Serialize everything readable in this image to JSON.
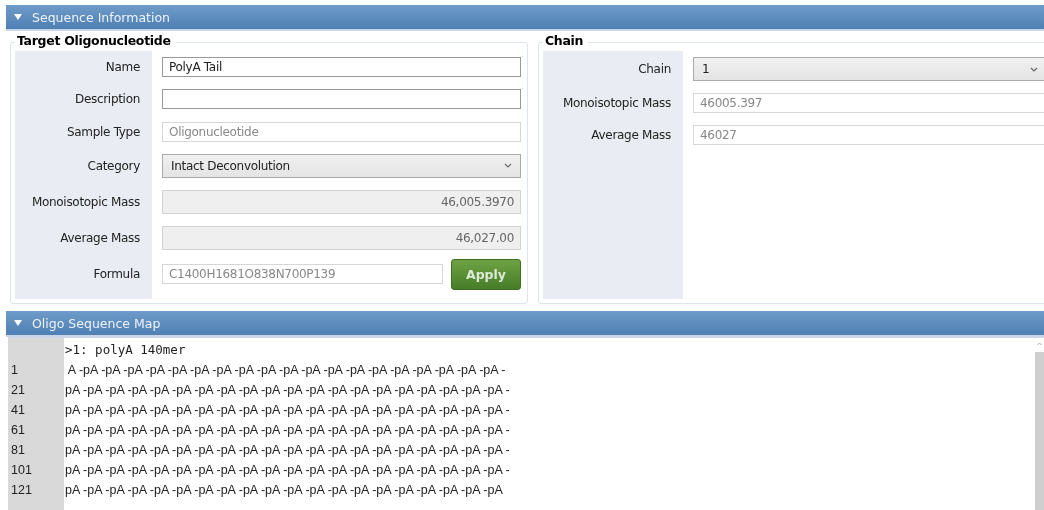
{
  "sequence_information": {
    "title": "Sequence Information",
    "expanded": true,
    "target_oligonucleotide": {
      "title": "Target Oligonucleotide",
      "fields": [
        {
          "label": "Name",
          "kind": "text",
          "value": "PolyA Tail"
        },
        {
          "label": "Description",
          "kind": "text"
        },
        {
          "label": "Sample Type",
          "kind": "readonly",
          "value": "Oligonucleotide"
        },
        {
          "label": "Category",
          "kind": "select",
          "value": "Intact Deconvolution"
        },
        {
          "label": "Monoisotopic Mass",
          "kind": "number",
          "value": "46,005.3970"
        },
        {
          "label": "Average Mass",
          "kind": "number",
          "value": "46,027.00"
        },
        {
          "label": "Formula",
          "kind": "formula",
          "value": "C1400H1681O838N700P139",
          "button": "Apply"
        }
      ]
    },
    "chain": {
      "title": "Chain",
      "fields": [
        {
          "label": "Chain",
          "kind": "select",
          "value": "1"
        },
        {
          "label": "Monoisotopic Mass",
          "kind": "readonly",
          "value": "46005.397"
        },
        {
          "label": "Average Mass",
          "kind": "readonly",
          "value": "46027"
        }
      ]
    }
  },
  "oligo_sequence_map": {
    "title": "Oligo Sequence Map",
    "expanded": true,
    "header": ">1: polyA 140mer",
    "lines": [
      {
        "number": "1",
        "text": " A -pA -pA -pA -pA -pA -pA -pA -pA -pA -pA -pA -pA -pA -pA -pA -pA -pA -pA -pA -"
      },
      {
        "number": "21",
        "text": "pA -pA -pA -pA -pA -pA -pA -pA -pA -pA -pA -pA -pA -pA -pA -pA -pA -pA -pA -pA -"
      },
      {
        "number": "41",
        "text": "pA -pA -pA -pA -pA -pA -pA -pA -pA -pA -pA -pA -pA -pA -pA -pA -pA -pA -pA -pA -"
      },
      {
        "number": "61",
        "text": "pA -pA -pA -pA -pA -pA -pA -pA -pA -pA -pA -pA -pA -pA -pA -pA -pA -pA -pA -pA -"
      },
      {
        "number": "81",
        "text": "pA -pA -pA -pA -pA -pA -pA -pA -pA -pA -pA -pA -pA -pA -pA -pA -pA -pA -pA -pA -"
      },
      {
        "number": "101",
        "text": "pA -pA -pA -pA -pA -pA -pA -pA -pA -pA -pA -pA -pA -pA -pA -pA -pA -pA -pA -pA -"
      },
      {
        "number": "121",
        "text": "pA -pA -pA -pA -pA -pA -pA -pA -pA -pA -pA -pA -pA -pA -pA -pA -pA -pA -pA -pA"
      }
    ]
  }
}
